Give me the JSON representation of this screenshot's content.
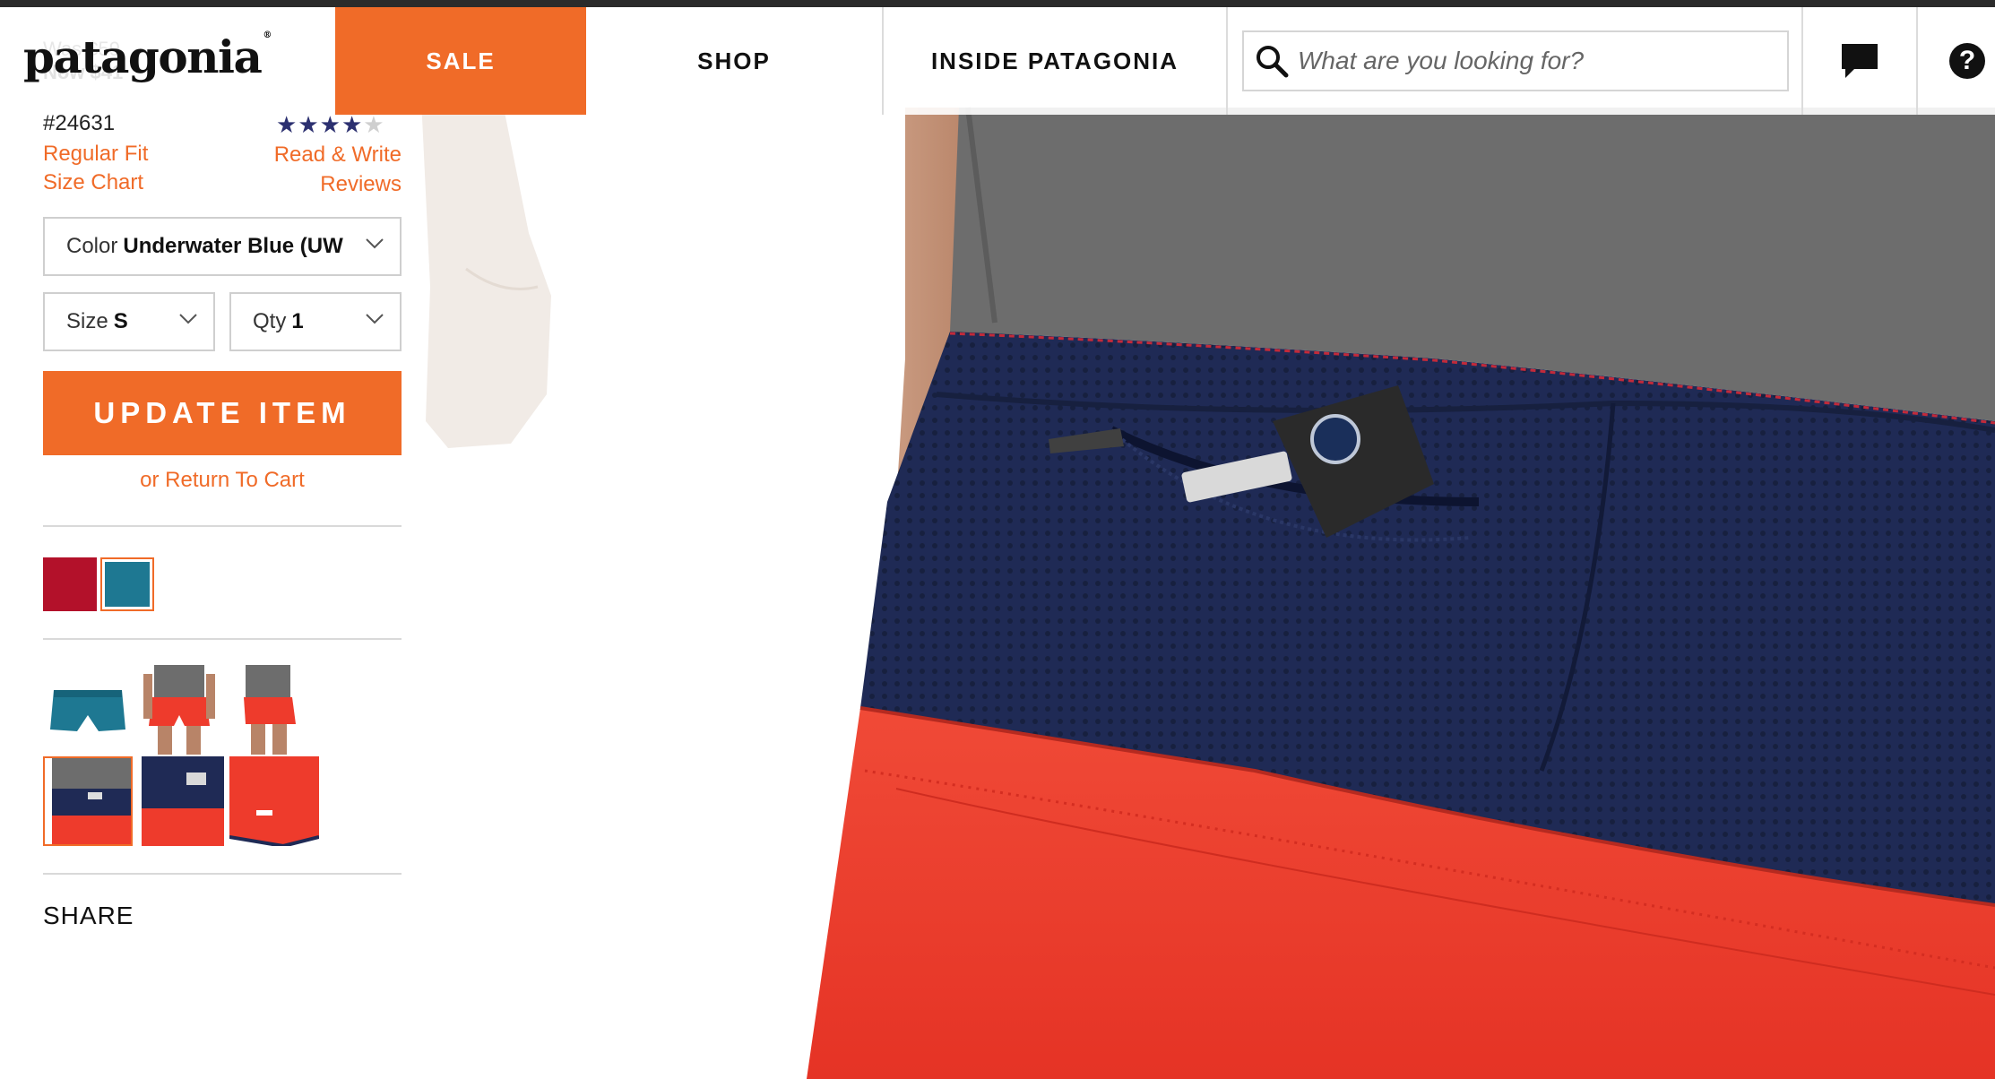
{
  "header": {
    "logo": "patagonia",
    "logo_mark": "®",
    "ghost_was": "Was $59",
    "ghost_now": "Now $41",
    "nav": {
      "sale": "SALE",
      "shop": "SHOP",
      "inside": "INSIDE PATAGONIA"
    },
    "search": {
      "placeholder": "What are you looking for?",
      "icon": "search-icon"
    },
    "chat_icon": "chat-bubble-icon",
    "help_icon": "help-icon",
    "help_glyph": "?"
  },
  "product": {
    "sku": "#24631",
    "rating": {
      "filled": 4,
      "total": 5
    },
    "links": {
      "regular_fit": "Regular Fit",
      "size_chart": "Size Chart",
      "reviews": "Read & Write Reviews"
    },
    "color": {
      "label": "Color",
      "value": "Underwater Blue (UW"
    },
    "size": {
      "label": "Size",
      "value": "S"
    },
    "qty": {
      "label": "Qty",
      "value": "1"
    },
    "update_button": "UPDATE ITEM",
    "return_link": "or Return To Cart",
    "swatches": [
      {
        "name": "red",
        "color": "#b3112a",
        "selected": false
      },
      {
        "name": "underwater-blue",
        "color": "#1e7892",
        "selected": true
      }
    ],
    "thumbnails_selected_index": 3,
    "share_label": "SHARE"
  },
  "colors": {
    "accent": "#f06b28",
    "star": "#2c3070",
    "navy": "#1f2a55",
    "red": "#ee3b2c",
    "gray_shirt": "#6d6d6d"
  }
}
